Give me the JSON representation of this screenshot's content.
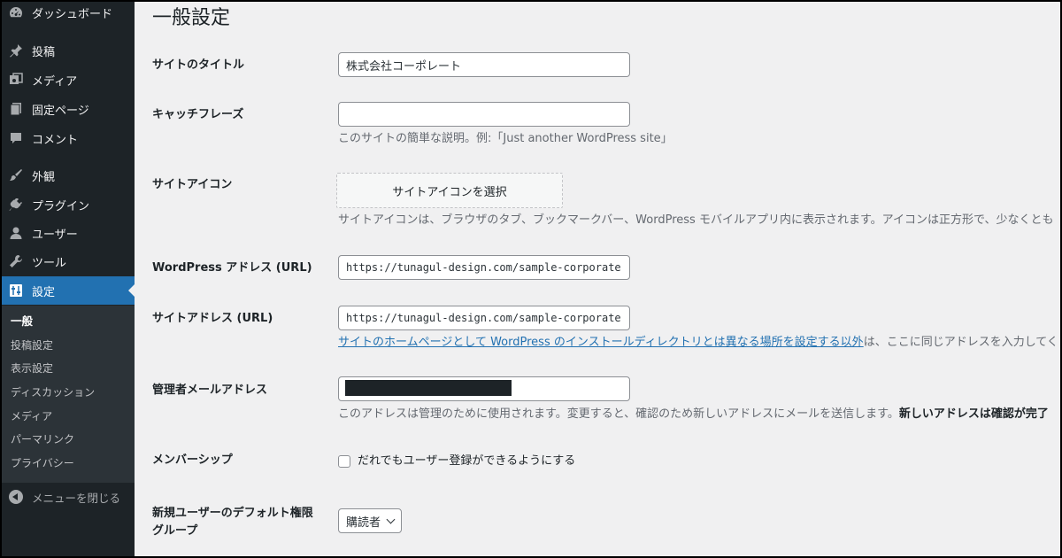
{
  "sidebar": {
    "items": [
      {
        "label": "ダッシュボード",
        "icon": "dashboard-icon"
      },
      {
        "label": "投稿",
        "icon": "pin-icon"
      },
      {
        "label": "メディア",
        "icon": "media-icon"
      },
      {
        "label": "固定ページ",
        "icon": "page-icon"
      },
      {
        "label": "コメント",
        "icon": "comment-icon"
      },
      {
        "label": "外観",
        "icon": "brush-icon"
      },
      {
        "label": "プラグイン",
        "icon": "plugin-icon"
      },
      {
        "label": "ユーザー",
        "icon": "user-icon"
      },
      {
        "label": "ツール",
        "icon": "wrench-icon"
      },
      {
        "label": "設定",
        "icon": "settings-icon"
      }
    ],
    "submenu": [
      "一般",
      "投稿設定",
      "表示設定",
      "ディスカッション",
      "メディア",
      "パーマリンク",
      "プライバシー"
    ],
    "collapse_label": "メニューを閉じる"
  },
  "main": {
    "title": "一般設定",
    "site_title": {
      "label": "サイトのタイトル",
      "value": "株式会社コーポレート"
    },
    "tagline": {
      "label": "キャッチフレーズ",
      "value": "",
      "description": "このサイトの簡単な説明。例:「Just another WordPress site」"
    },
    "site_icon": {
      "label": "サイトアイコン",
      "button": "サイトアイコンを選択",
      "description": "サイトアイコンは、ブラウザのタブ、ブックマークバー、WordPress モバイルアプリ内に表示されます。アイコンは正方形で、少なくとも"
    },
    "wp_address": {
      "label": "WordPress アドレス (URL)",
      "value": "https://tunagul-design.com/sample-corporate"
    },
    "site_address": {
      "label": "サイトアドレス (URL)",
      "value": "https://tunagul-design.com/sample-corporate",
      "link_text": "サイトのホームページとして WordPress のインストールディレクトリとは異なる場所を設定する以外",
      "description_rest": "は、ここに同じアドレスを入力してく"
    },
    "admin_email": {
      "label": "管理者メールアドレス",
      "description": "このアドレスは管理のために使用されます。変更すると、確認のため新しいアドレスにメールを送信します。",
      "description_bold": "新しいアドレスは確認が完了"
    },
    "membership": {
      "label": "メンバーシップ",
      "checkbox_label": "だれでもユーザー登録ができるようにする"
    },
    "default_role": {
      "label_line1": "新規ユーザーのデフォルト権限",
      "label_line2": "グループ",
      "selected": "購読者"
    }
  }
}
